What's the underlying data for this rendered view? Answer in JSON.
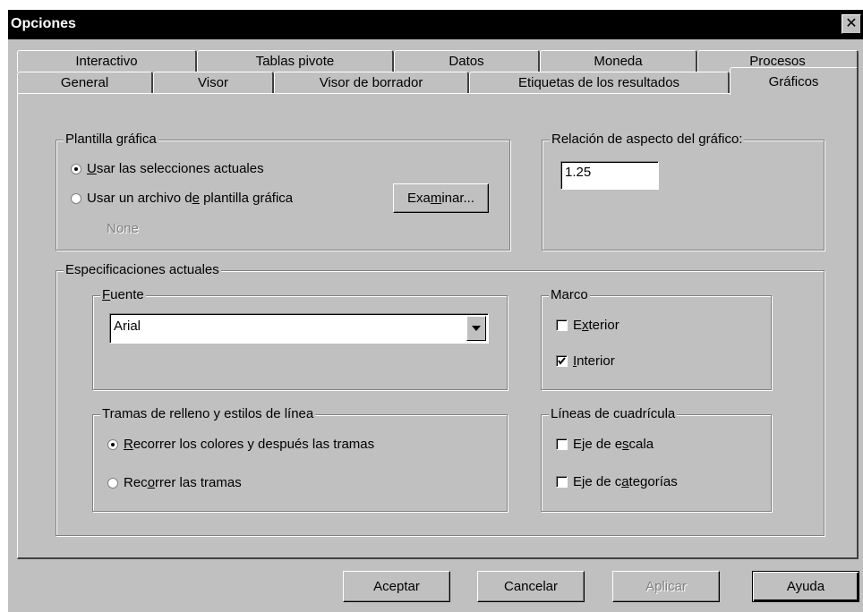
{
  "window": {
    "title": "Opciones",
    "close_glyph": "✕"
  },
  "tabs_back_row": [
    {
      "label": "Interactivo"
    },
    {
      "label": "Tablas pivote"
    },
    {
      "label": "Datos"
    },
    {
      "label": "Moneda"
    },
    {
      "label": "Procesos"
    }
  ],
  "tabs_front_row": [
    {
      "label": "General"
    },
    {
      "label": "Visor"
    },
    {
      "label": "Visor de borrador"
    },
    {
      "label": "Etiquetas de los resultados"
    },
    {
      "label": "Gráficos",
      "active": true
    }
  ],
  "plantilla": {
    "group_label": "Plantilla gráfica",
    "option_current": {
      "pre": "",
      "mnemonic": "U",
      "post": "sar las selecciones actuales",
      "checked": true
    },
    "option_file": {
      "pre": "Usar un archivo d",
      "mnemonic": "e",
      "post": " plantilla gráfica",
      "checked": false
    },
    "template_name": "None",
    "browse_button": {
      "pre": "Exa",
      "mnemonic": "m",
      "post": "inar..."
    }
  },
  "aspect": {
    "group_label": "Relación de aspecto del gráfico:",
    "value": "1.25"
  },
  "current_specs": {
    "group_label": "Especificaciones actuales",
    "font": {
      "label_mnemonic": "F",
      "label_rest": "uente",
      "selected": "Arial"
    },
    "frame": {
      "group_label": "Marco",
      "outer": {
        "pre": "E",
        "mnemonic": "x",
        "post": "terior",
        "checked": false
      },
      "inner": {
        "pre": "",
        "mnemonic": "I",
        "post": "nterior",
        "checked": true
      }
    },
    "fills": {
      "group_label": "Tramas de relleno y estilos de línea",
      "cycle_colors": {
        "pre": "",
        "mnemonic": "R",
        "post": "ecorrer los colores y después las tramas",
        "checked": true
      },
      "cycle_patterns": {
        "pre": "Rec",
        "mnemonic": "o",
        "post": "rrer las tramas",
        "checked": false
      }
    },
    "gridlines": {
      "group_label": "Líneas de cuadrícula",
      "scale_axis": {
        "pre": "Eje de e",
        "mnemonic": "s",
        "post": "cala",
        "checked": false
      },
      "category_axis": {
        "pre": "Eje de c",
        "mnemonic": "a",
        "post": "tegorías",
        "checked": false
      }
    }
  },
  "footer": {
    "ok": "Aceptar",
    "cancel": "Cancelar",
    "apply": "Aplicar",
    "help": "Ayuda"
  },
  "colors": {
    "dialog_face": "#c0c0c0",
    "titlebar": "#000000",
    "disabled_text": "#808080"
  }
}
